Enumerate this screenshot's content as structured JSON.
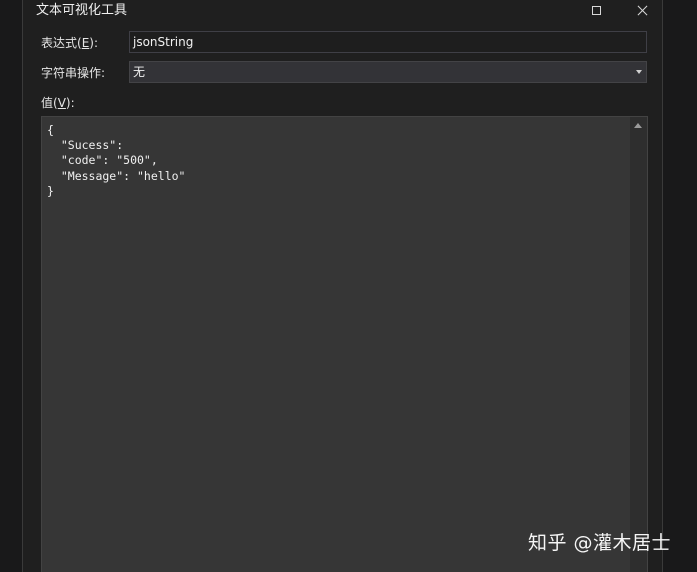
{
  "window": {
    "title": "文本可视化工具",
    "maximize_glyph": "maximize-icon",
    "close_glyph": "close-icon"
  },
  "expression": {
    "label_text": "表达式",
    "label_mnemonic": "E",
    "label_suffix": "):",
    "label_prefix": "(",
    "value": "jsonString"
  },
  "string_operation": {
    "label": "字符串操作:",
    "selected": "无"
  },
  "value_section": {
    "label_text": "值",
    "label_prefix": "(",
    "label_mnemonic": "V",
    "label_suffix": "):",
    "content": "{\n  \"Sucess\":\n  \"code\": \"500\",\n  \"Message\": \"hello\"\n}"
  },
  "watermark": {
    "text": "知乎 @灌木居士"
  }
}
